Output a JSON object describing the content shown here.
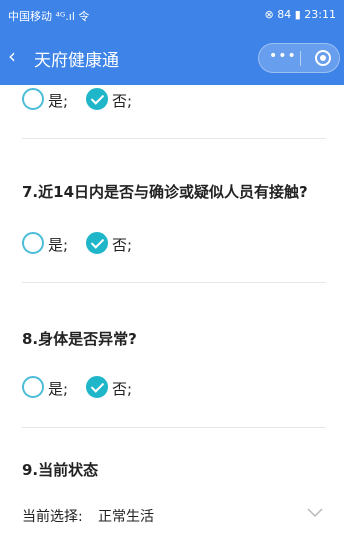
{
  "status_bar": {
    "left": "中国移动 ⁴ᴳ.ıl 令",
    "right": "⊗ 84 ▮ 23:11"
  },
  "nav": {
    "title": "天府健康通",
    "back_icon": "chevron-left-icon",
    "menu_icon": "more-dots-icon",
    "close_icon": "close-circle-icon"
  },
  "questions": [
    {
      "number_title": "",
      "options": [
        {
          "label": "是;",
          "checked": false
        },
        {
          "label": "否;",
          "checked": true
        }
      ]
    },
    {
      "number_title": "7.近14日内是否与确诊或疑似人员有接触?",
      "options": [
        {
          "label": "是;",
          "checked": false
        },
        {
          "label": "否;",
          "checked": true
        }
      ]
    },
    {
      "number_title": "8.身体是否异常?",
      "options": [
        {
          "label": "是;",
          "checked": false
        },
        {
          "label": "否;",
          "checked": true
        }
      ]
    }
  ],
  "status_question": {
    "title": "9.当前状态",
    "select_label": "当前选择:",
    "select_value": "正常生活"
  },
  "colors": {
    "nav_bg": "#3d83e8",
    "radio_checked": "#1fb6c9",
    "radio_ring": "#4cbdd8"
  }
}
